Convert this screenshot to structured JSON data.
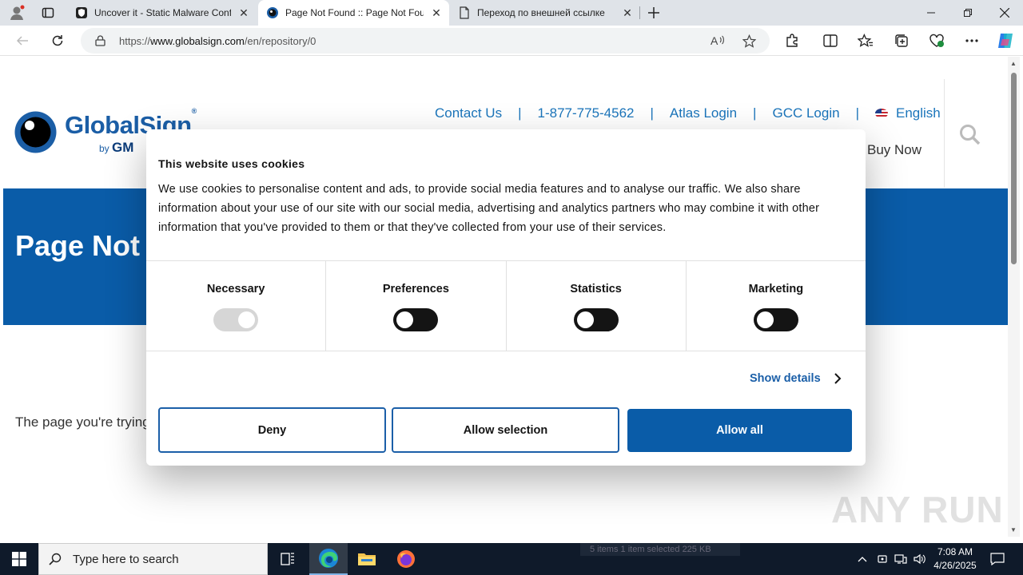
{
  "browser": {
    "tabs": [
      {
        "title": "Uncover it - Static Malware Confi",
        "active": false
      },
      {
        "title": "Page Not Found :: Page Not Foun",
        "active": true
      },
      {
        "title": "Переход по внешней ссылке",
        "active": false
      }
    ],
    "url_prefix": "https://",
    "url_domain": "www.globalsign.com",
    "url_path": "/en/repository/0"
  },
  "site": {
    "logo_text": "GlobalSign",
    "logo_sub_by": "by",
    "logo_sub_brand": "GM",
    "nav": {
      "contact": "Contact Us",
      "phone": "1-877-775-4562",
      "atlas": "Atlas Login",
      "gcc": "GCC Login",
      "language": "English",
      "separator": "|"
    },
    "buy_now": "Buy Now",
    "hero_title": "Page Not",
    "body_text": "The page you're trying"
  },
  "cookie_dialog": {
    "title": "This website uses cookies",
    "text": "We use cookies to personalise content and ads, to provide social media features and to analyse our traffic. We also share information about your use of our site with our social media, advertising and analytics partners who may combine it with other information that you've provided to them or that they've collected from your use of their services.",
    "categories": [
      {
        "label": "Necessary",
        "enabled": true,
        "locked": true
      },
      {
        "label": "Preferences",
        "enabled": false
      },
      {
        "label": "Statistics",
        "enabled": false
      },
      {
        "label": "Marketing",
        "enabled": false
      }
    ],
    "show_details": "Show details",
    "buttons": {
      "deny": "Deny",
      "allow_selection": "Allow selection",
      "allow_all": "Allow all"
    }
  },
  "taskbar": {
    "search_placeholder": "Type here to search",
    "time": "7:08 AM",
    "date": "4/26/2025",
    "status_items": "5 items",
    "status_selected": "1 item selected  225 KB"
  },
  "watermark": "ANY RUN",
  "colors": {
    "brand_blue": "#0a5ca8",
    "link_blue": "#1b75bb",
    "taskbar": "#0f1a2a"
  }
}
